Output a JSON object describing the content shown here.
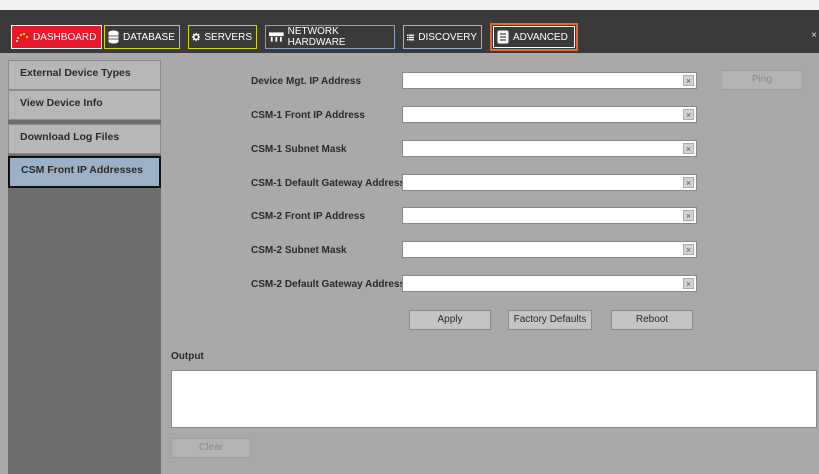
{
  "tabs": {
    "dashboard": "DASHBOARD",
    "database": "DATABASE",
    "servers": "SERVERS",
    "network_hardware": "NETWORK HARDWARE",
    "discovery": "DISCOVERY",
    "advanced": "ADVANCED"
  },
  "close_glyph": "×",
  "sidebar": {
    "items": [
      {
        "label": "External Device Types"
      },
      {
        "label": "View Device Info"
      },
      {
        "label": "Download Log Files"
      },
      {
        "label": "CSM Front IP Addresses"
      }
    ]
  },
  "form": {
    "fields": [
      {
        "label": "Device Mgt. IP Address",
        "value": ""
      },
      {
        "label": "CSM-1 Front IP Address",
        "value": ""
      },
      {
        "label": "CSM-1 Subnet Mask",
        "value": ""
      },
      {
        "label": "CSM-1 Default Gateway Address",
        "value": ""
      },
      {
        "label": "CSM-2 Front IP Address",
        "value": ""
      },
      {
        "label": "CSM-2 Subnet Mask",
        "value": ""
      },
      {
        "label": "CSM-2 Default Gateway Address",
        "value": ""
      }
    ],
    "clear_glyph": "×",
    "ping": "Ping",
    "apply": "Apply",
    "factory_defaults": "Factory Defaults",
    "reboot": "Reboot"
  },
  "output": {
    "label": "Output",
    "text": "",
    "clear": "Clear"
  },
  "colors": {
    "accent_active_tab": "#e06a3a",
    "dashboard_bg": "#e8192c",
    "sidebar_active": "#9cb0c8"
  }
}
